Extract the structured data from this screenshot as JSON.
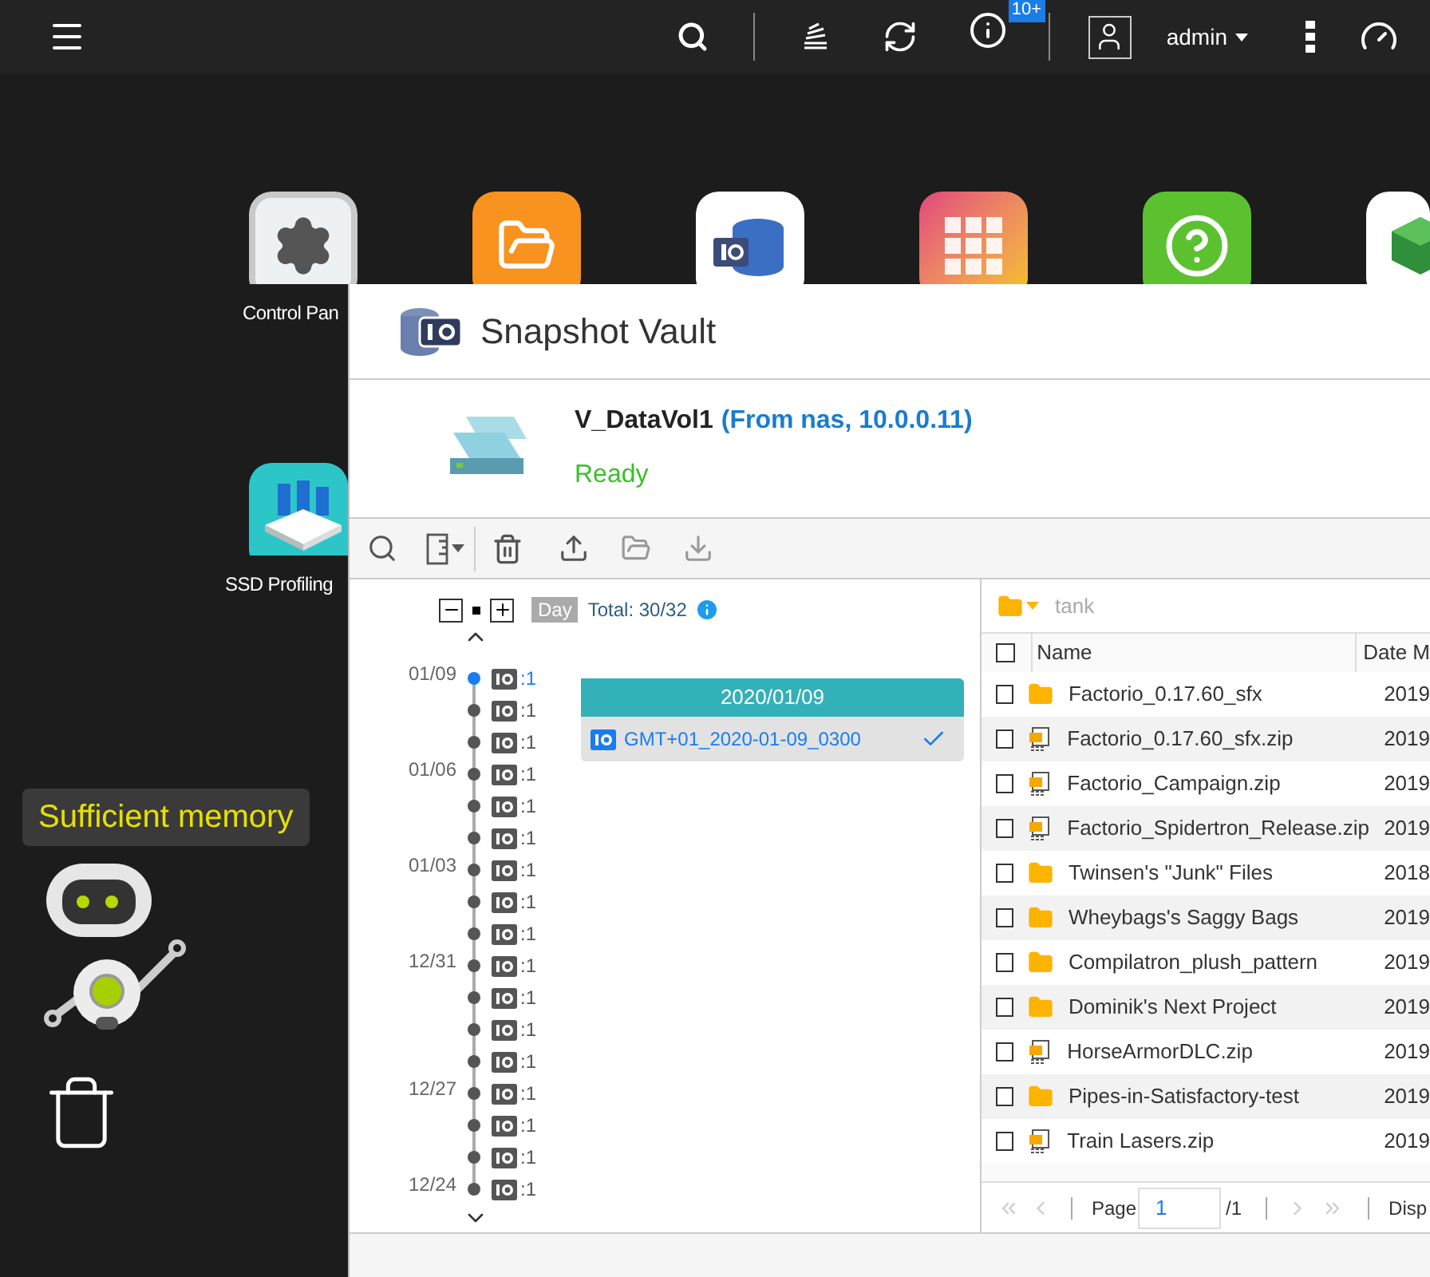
{
  "top_bar": {
    "notification_badge": "10+",
    "user": "admin"
  },
  "desktop": {
    "icons": [
      {
        "kind": "settings",
        "label": "Control Pan"
      },
      {
        "kind": "folder"
      },
      {
        "kind": "storage"
      },
      {
        "kind": "apps"
      },
      {
        "kind": "help"
      },
      {
        "kind": "box"
      },
      {
        "kind": "ssd",
        "label": "SSD Profiling"
      }
    ],
    "memory_tip": "Sufficient memory"
  },
  "window": {
    "title": "Snapshot Vault",
    "volume": {
      "name": "V_DataVol1",
      "source": "(From nas, 10.0.0.11)",
      "status": "Ready"
    },
    "timeline": {
      "scale": "Day",
      "total": "Total: 30/32",
      "entries": [
        {
          "date": "01/09",
          "count": ":1",
          "selected": true
        },
        {
          "count": ":1",
          "selected": false
        },
        {
          "count": ":1",
          "selected": false
        },
        {
          "date": "01/06",
          "count": ":1",
          "selected": false
        },
        {
          "count": ":1",
          "selected": false
        },
        {
          "count": ":1",
          "selected": false
        },
        {
          "date": "01/03",
          "count": ":1",
          "selected": false
        },
        {
          "count": ":1",
          "selected": false
        },
        {
          "count": ":1",
          "selected": false
        },
        {
          "date": "12/31",
          "count": ":1",
          "selected": false
        },
        {
          "count": ":1",
          "selected": false
        },
        {
          "count": ":1",
          "selected": false
        },
        {
          "count": ":1",
          "selected": false
        },
        {
          "date": "12/27",
          "count": ":1",
          "selected": false
        },
        {
          "count": ":1",
          "selected": false
        },
        {
          "count": ":1",
          "selected": false
        },
        {
          "date": "12/24",
          "count": ":1",
          "selected": false
        }
      ]
    },
    "snapshot_card": {
      "date": "2020/01/09",
      "items": [
        {
          "name": "GMT+01_2020-01-09_0300",
          "checked": true
        }
      ]
    },
    "file_browser": {
      "path": "tank",
      "select_all": {
        "checked": false
      },
      "columns": [
        "Name",
        "Date M"
      ],
      "rows": [
        {
          "kind": "folder",
          "name": "Factorio_0.17.60_sfx",
          "date": "2019",
          "checked": false
        },
        {
          "kind": "archive",
          "name": "Factorio_0.17.60_sfx.zip",
          "date": "2019",
          "checked": false
        },
        {
          "kind": "archive",
          "name": "Factorio_Campaign.zip",
          "date": "2019",
          "checked": false
        },
        {
          "kind": "archive",
          "name": "Factorio_Spidertron_Release.zip",
          "date": "2019",
          "checked": false
        },
        {
          "kind": "folder",
          "name": "Twinsen's \"Junk\" Files",
          "date": "2018",
          "checked": false
        },
        {
          "kind": "folder",
          "name": "Wheybags's Saggy Bags",
          "date": "2019",
          "checked": false
        },
        {
          "kind": "folder",
          "name": "Compilatron_plush_pattern",
          "date": "2019",
          "checked": false
        },
        {
          "kind": "folder",
          "name": "Dominik's Next Project",
          "date": "2019",
          "checked": false
        },
        {
          "kind": "archive",
          "name": "HorseArmorDLC.zip",
          "date": "2019",
          "checked": false
        },
        {
          "kind": "folder",
          "name": "Pipes-in-Satisfactory-test",
          "date": "2019",
          "checked": false
        },
        {
          "kind": "archive",
          "name": "Train Lasers.zip",
          "date": "2019",
          "checked": false
        }
      ],
      "pager": {
        "page_label": "Page",
        "page": "1",
        "total": "/1",
        "display": "Disp"
      }
    }
  }
}
